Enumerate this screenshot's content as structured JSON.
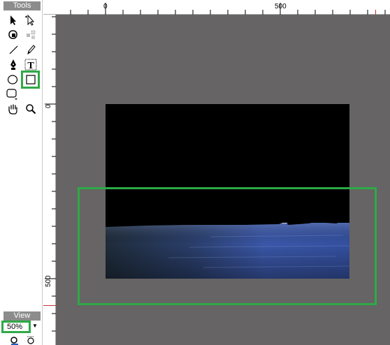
{
  "tools_panel": {
    "title": "Tools",
    "tools": [
      {
        "name": "arrow-icon"
      },
      {
        "name": "subselect-icon"
      },
      {
        "name": "lasso-icon"
      },
      {
        "name": "magic-wand-icon"
      },
      {
        "name": "line-icon"
      },
      {
        "name": "pencil-icon"
      },
      {
        "name": "pen-icon"
      },
      {
        "name": "text-icon",
        "glyph": "T"
      },
      {
        "name": "oval-icon"
      },
      {
        "name": "rectangle-icon",
        "selected": true
      },
      {
        "name": "rounded-rectangle-icon"
      },
      {
        "name": "hand-icon"
      },
      {
        "name": "zoom-icon"
      }
    ],
    "accent_color": "#2eaa46"
  },
  "view_panel": {
    "title": "View",
    "zoom_value": "50%",
    "dropdown_arrow": "▼"
  },
  "rulers": {
    "top_labels": [
      "0",
      "500"
    ],
    "left_labels": [
      "0",
      "500"
    ]
  },
  "canvas": {
    "background": "#666464",
    "image_background": "#000000"
  }
}
